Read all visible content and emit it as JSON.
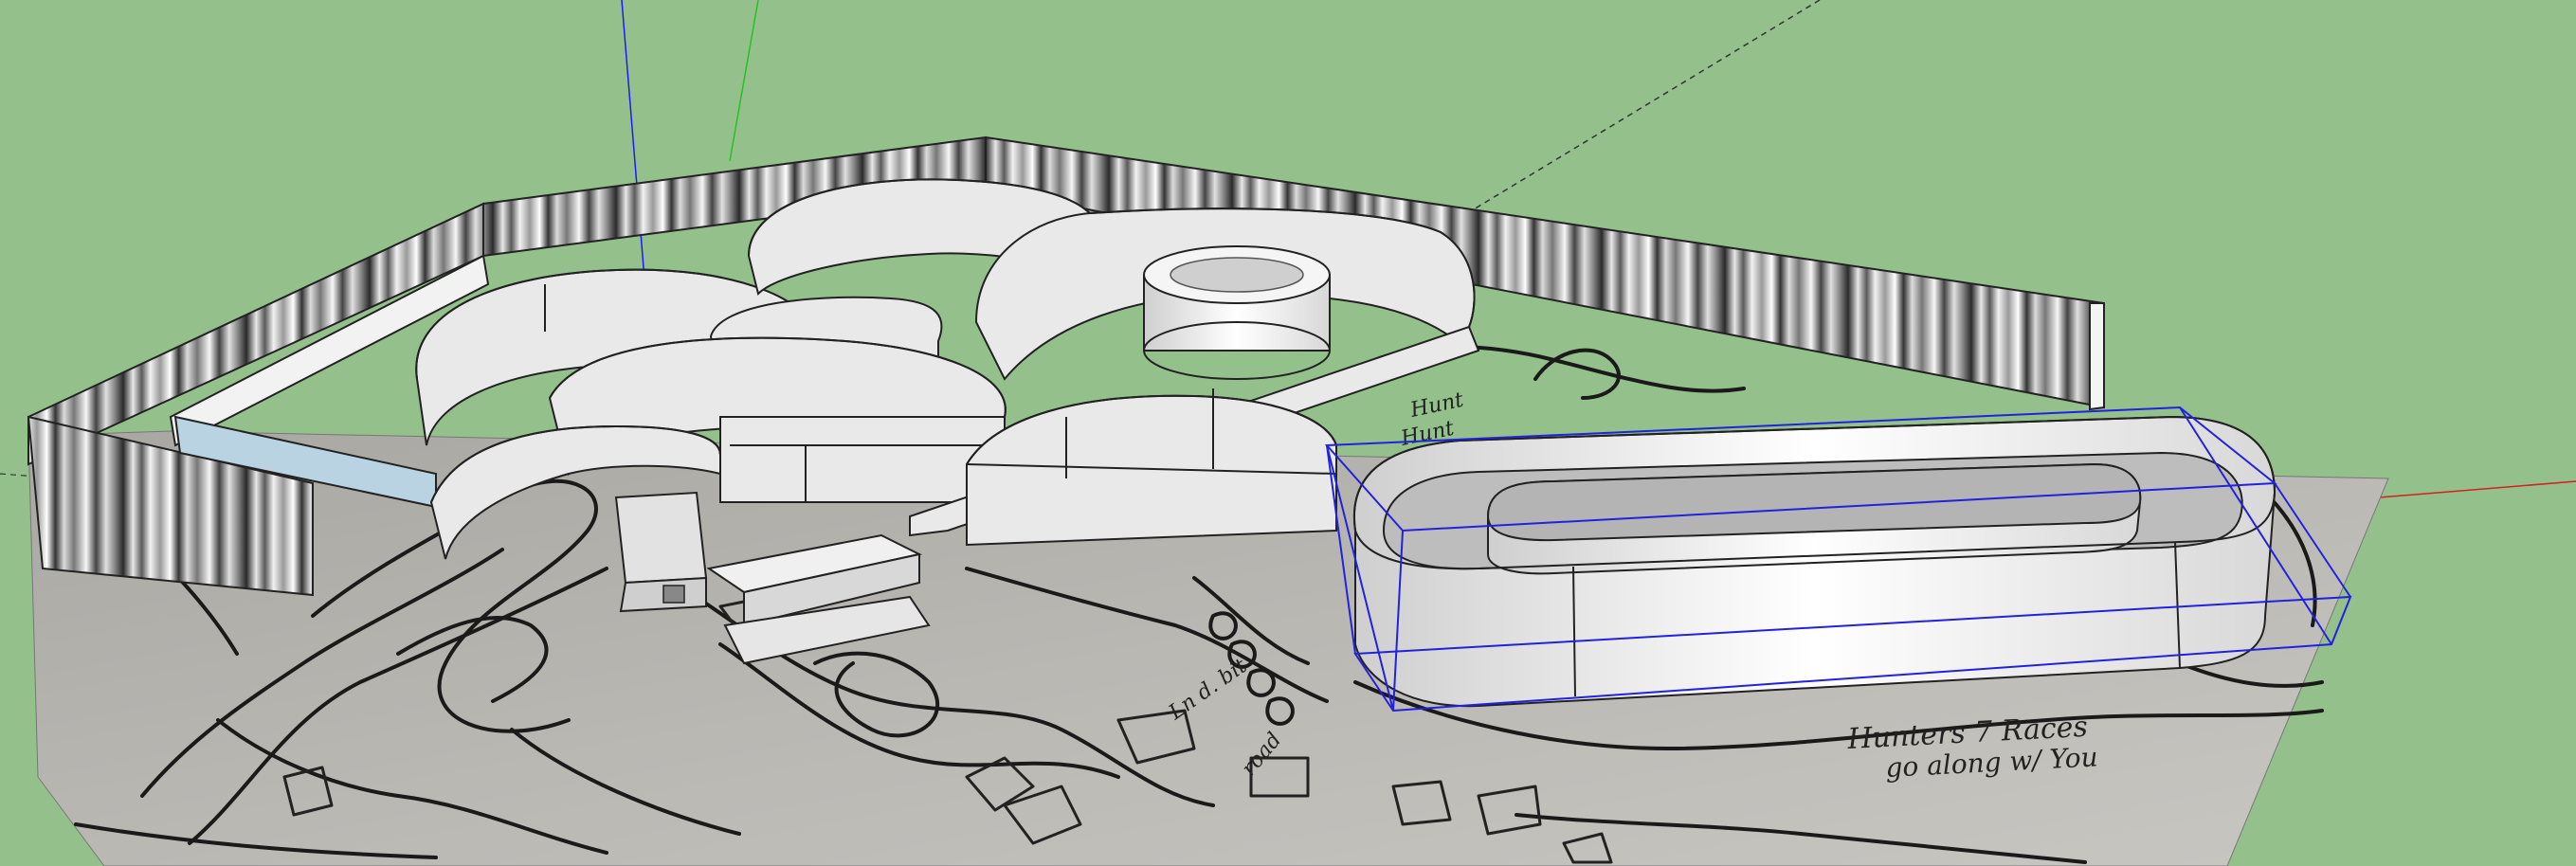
{
  "viewport": {
    "background_color": "#94c08c",
    "axis_colors": {
      "blue": "#1a1aff",
      "green": "#27c027",
      "red": "#d42020"
    },
    "selection_color": "#2222dd"
  },
  "terrain_sketch": {
    "handwritten_note_line1": "Hunters 7 Races",
    "handwritten_note_line2": "go along w/ You",
    "scribble_a": "Hunt",
    "scribble_b": "Hunt",
    "scribble_c": "Ln d. bit",
    "scribble_d": "road"
  }
}
